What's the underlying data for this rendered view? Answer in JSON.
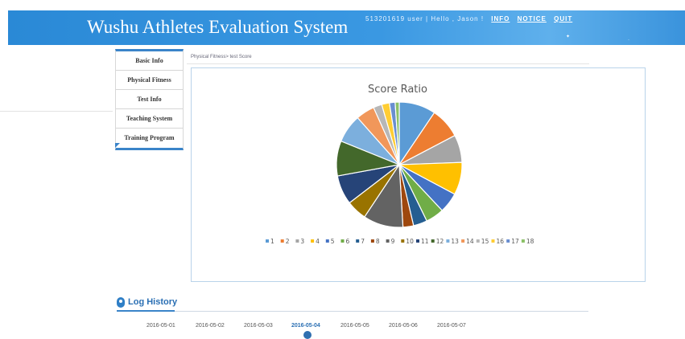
{
  "header": {
    "title": "Wushu Athletes Evaluation System",
    "user_info": "513201619 user | Hello , Jason !",
    "links": [
      "INFO",
      "NOTICE",
      "QUIT"
    ]
  },
  "sidebar": {
    "items": [
      {
        "label": "Basic Info"
      },
      {
        "label": "Physical Fitness"
      },
      {
        "label": "Test Info"
      },
      {
        "label": "Teaching System"
      },
      {
        "label": "Training Program"
      }
    ]
  },
  "breadcrumb": "Physical Fitness> test Score",
  "chart_data": {
    "type": "pie",
    "title": "Score Ratio",
    "legend_position": "bottom",
    "categories": [
      "1",
      "2",
      "3",
      "4",
      "5",
      "6",
      "7",
      "8",
      "9",
      "10",
      "11",
      "12",
      "13",
      "14",
      "15",
      "16",
      "17",
      "18"
    ],
    "values": [
      9.0,
      7.5,
      6.8,
      8.0,
      5.0,
      4.5,
      3.4,
      2.6,
      9.8,
      5.0,
      7.2,
      8.6,
      7.0,
      4.6,
      2.1,
      1.9,
      1.4,
      1.0
    ],
    "colors": [
      "#5b9bd5",
      "#ed7d31",
      "#a5a5a5",
      "#ffc000",
      "#4472c4",
      "#70ad47",
      "#255e91",
      "#9e480e",
      "#636363",
      "#997300",
      "#264478",
      "#43682b",
      "#7cafdd",
      "#f1975a",
      "#b7b7b7",
      "#ffcd33",
      "#698ed0",
      "#8cc168"
    ]
  },
  "log": {
    "title": "Log History",
    "dates": [
      "2016-05-01",
      "2016-05-02",
      "2016-05-03",
      "2016-05-04",
      "2016-05-05",
      "2016-05-06",
      "2016-05-07"
    ],
    "active": "2016-05-04"
  }
}
